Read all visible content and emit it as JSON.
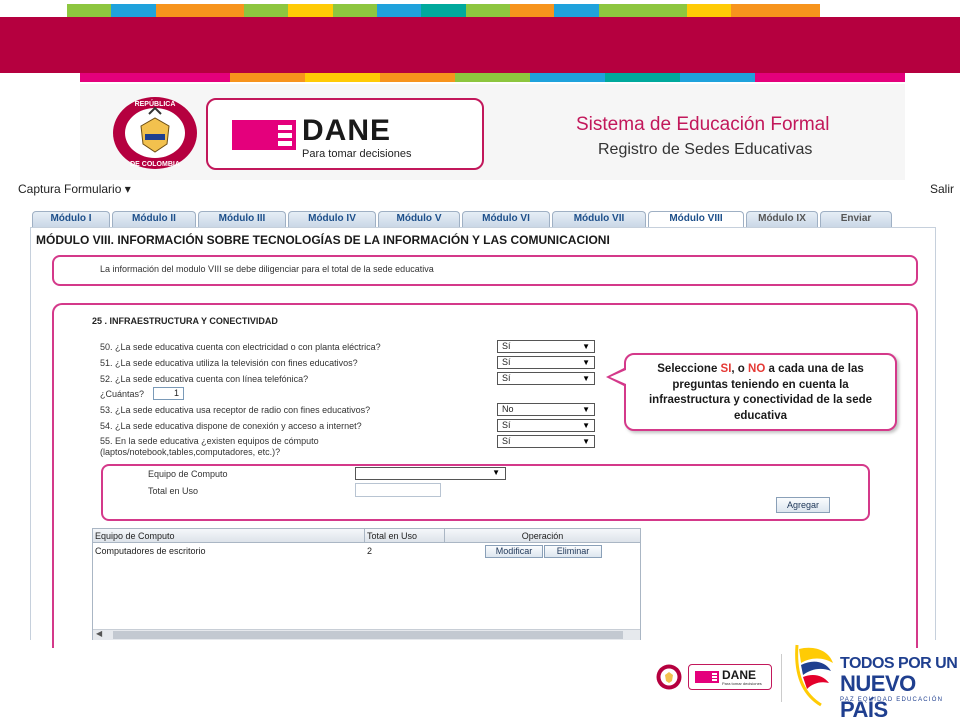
{
  "colors": {
    "brand_magenta": "#b5003f",
    "accent_pink": "#d4398a",
    "tab_text": "#1d4f8a",
    "gov_blue": "#1f3f8f",
    "highlight_red": "#e53935",
    "stripe_palette": [
      "#8dc63f",
      "#1fa2dc",
      "#f7941d",
      "#ffcb05",
      "#00a99d",
      "#e4007c"
    ]
  },
  "header": {
    "seal_text_top": "REPÚBLICA",
    "seal_text_bottom": "DE COLOMBIA",
    "dane_logo": "DANE",
    "dane_tagline": "Para tomar decisiones",
    "system_title": "Sistema de Educación Formal",
    "system_subtitle": "Registro de Sedes Educativas"
  },
  "menubar": {
    "captura": "Captura Formulario",
    "salir": "Salir"
  },
  "tabs": [
    {
      "label": "Módulo I"
    },
    {
      "label": "Módulo II"
    },
    {
      "label": "Módulo III"
    },
    {
      "label": "Módulo IV"
    },
    {
      "label": "Módulo V"
    },
    {
      "label": "Módulo VI"
    },
    {
      "label": "Módulo VII"
    },
    {
      "label": "Módulo VIII"
    },
    {
      "label": "Módulo IX"
    },
    {
      "label": "Enviar"
    }
  ],
  "active_tab": "Módulo VIII",
  "module_title": "MÓDULO VIII. INFORMACIÓN SOBRE TECNOLOGÍAS DE LA INFORMACIÓN Y LAS COMUNICACIONI",
  "info_text": "La información del modulo VIII se debe diligenciar para el total de la sede educativa",
  "section": {
    "title": "25 . INFRAESTRUCTURA Y CONECTIVIDAD",
    "questions": [
      {
        "label": "50. ¿La sede educativa cuenta con electricidad o con planta eléctrica?",
        "value": "Sí"
      },
      {
        "label": "51. ¿La sede educativa utiliza la televisión con fines educativos?",
        "value": "Sí"
      },
      {
        "label": "52. ¿La sede educativa cuenta con línea telefónica?",
        "value": "Sí"
      },
      {
        "label": "53. ¿La sede educativa usa receptor de radio con fines educativos?",
        "value": "No"
      },
      {
        "label": "54. ¿La sede educativa dispone de conexión y acceso a internet?",
        "value": "Sí"
      },
      {
        "label": "55. En la sede educativa ¿existen equipos de cómputo",
        "label2": "(laptos/notebook,tables,computadores, etc.)?",
        "value": "Sí"
      }
    ],
    "cuantas_label": "¿Cuántas?",
    "cuantas_value": "1"
  },
  "callout": {
    "part1": "Seleccione ",
    "si": "SI",
    "part2": ", o ",
    "no": "NO",
    "part3": "  a cada una de las preguntas teniendo en cuenta la infraestructura y conectividad de la sede educativa"
  },
  "equipment_form": {
    "equipo_label": "Equipo de Computo",
    "total_label": "Total en Uso",
    "equipo_value": "",
    "total_value": "",
    "add_button": "Agregar"
  },
  "grid": {
    "columns": [
      "Equipo de Computo",
      "Total en Uso",
      "Operación"
    ],
    "rows": [
      {
        "equipo": "Computadores de escritorio",
        "total": "2",
        "edit": "Modificar",
        "delete": "Eliminar"
      }
    ]
  },
  "footer": {
    "dane_logo": "DANE",
    "dane_tagline": "Para tomar decisiones",
    "gov_line1": "TODOS POR UN",
    "gov_line2": "NUEVO PAÍS",
    "gov_line3": "PAZ  EQUIDAD  EDUCACIÓN"
  }
}
